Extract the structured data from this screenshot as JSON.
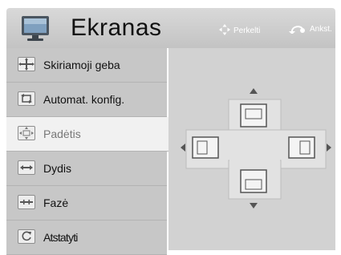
{
  "header": {
    "title": "Ekranas",
    "hints": {
      "move": "Perkelti",
      "back": "Ankst."
    }
  },
  "menu": {
    "items": [
      {
        "label": "Skiriamoji geba",
        "icon": "resolution-icon"
      },
      {
        "label": "Automat. konfig.",
        "icon": "auto-config-icon"
      },
      {
        "label": "Padėtis",
        "icon": "position-icon",
        "selected": true
      },
      {
        "label": "Dydis",
        "icon": "size-icon"
      },
      {
        "label": "Fazė",
        "icon": "phase-icon"
      },
      {
        "label": "Atstatyti",
        "icon": "reset-icon"
      }
    ]
  },
  "colors": {
    "header": "#c8c8c8",
    "menu_item": "#c7c7c7",
    "menu_selected": "#f1f1f1",
    "panel": "#d2d2d2"
  }
}
